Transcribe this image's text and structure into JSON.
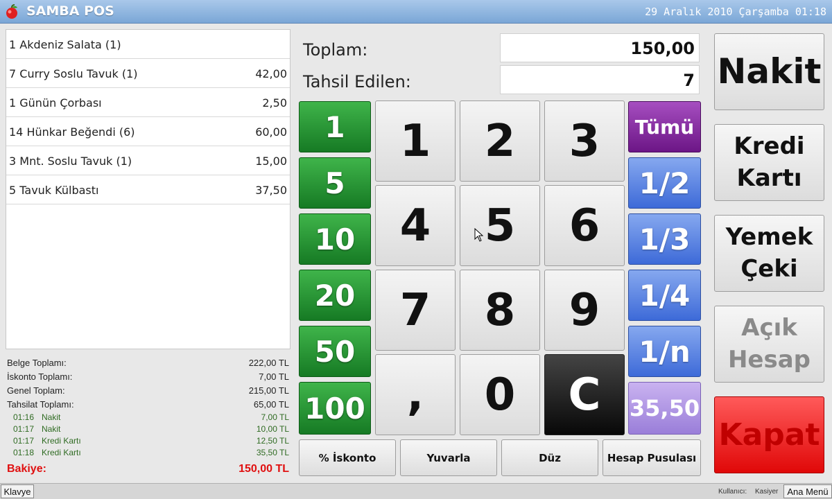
{
  "titlebar": {
    "title": "SAMBA POS",
    "datetime": "29 Aralık 2010 Çarşamba 01:18"
  },
  "order_items": [
    {
      "name": "1  Akdeniz Salata (1)",
      "price": ""
    },
    {
      "name": "7  Curry Soslu Tavuk (1)",
      "price": "42,00"
    },
    {
      "name": "1  Günün Çorbası",
      "price": "2,50"
    },
    {
      "name": "14  Hünkar Beğendi (6)",
      "price": "60,00"
    },
    {
      "name": "3  Mnt. Soslu Tavuk (1)",
      "price": "15,00"
    },
    {
      "name": "5  Tavuk Külbastı",
      "price": "37,50"
    }
  ],
  "totals": {
    "belge_label": "Belge Toplamı:",
    "belge_value": "222,00 TL",
    "iskonto_label": "İskonto Toplamı:",
    "iskonto_value": "7,00 TL",
    "genel_label": "Genel Toplam:",
    "genel_value": "215,00 TL",
    "tahsilat_label": "Tahsilat Toplamı:",
    "tahsilat_value": "65,00 TL",
    "payments": [
      {
        "time": "01:16",
        "type": "Nakit",
        "amount": "7,00 TL"
      },
      {
        "time": "01:17",
        "type": "Nakit",
        "amount": "10,00 TL"
      },
      {
        "time": "01:17",
        "type": "Kredi Kartı",
        "amount": "12,50 TL"
      },
      {
        "time": "01:18",
        "type": "Kredi Kartı",
        "amount": "35,50 TL"
      }
    ],
    "bakiye_label": "Bakiye:",
    "bakiye_value": "150,00 TL"
  },
  "summary": {
    "toplam_label": "Toplam:",
    "toplam_value": "150,00",
    "tahsil_label": "Tahsil Edilen:",
    "tahsil_value": "7"
  },
  "quick_amounts": [
    "1",
    "5",
    "10",
    "20",
    "50",
    "100"
  ],
  "keypad": [
    "1",
    "2",
    "3",
    "4",
    "5",
    "6",
    "7",
    "8",
    "9",
    ",",
    "0",
    "C"
  ],
  "splits": [
    "Tümü",
    "1/2",
    "1/3",
    "1/4",
    "1/n",
    "35,50"
  ],
  "actions": [
    "% İskonto",
    "Yuvarla",
    "Düz",
    "Hesap Pusulası"
  ],
  "payment_types": {
    "nakit": "Nakit",
    "kredi_line1": "Kredi",
    "kredi_line2": "Kartı",
    "yemek_line1": "Yemek",
    "yemek_line2": "Çeki",
    "acik_line1": "Açık",
    "acik_line2": "Hesap",
    "kapat": "Kapat"
  },
  "statusbar": {
    "keyboard": "Klavye",
    "user_label": "Kullanıcı:",
    "user_value": "Kasiyer",
    "main_menu": "Ana Menü"
  },
  "colors": {
    "quick": "#167a24",
    "tumu": "#6c1686",
    "split": "#3d6ad8",
    "kapat": "#e00808",
    "bakiye": "#e01010"
  }
}
